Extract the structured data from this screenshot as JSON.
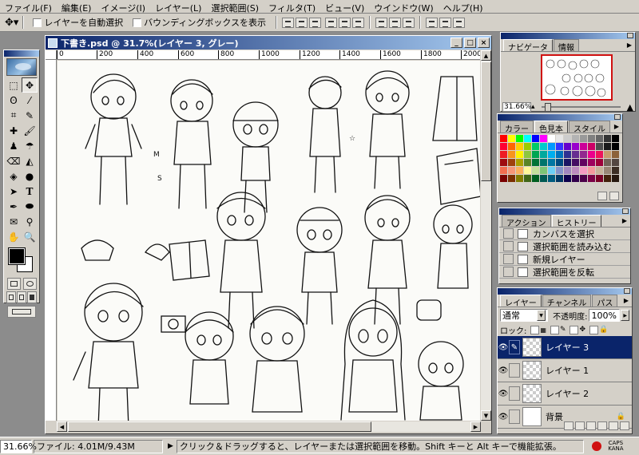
{
  "menu": [
    "ファイル(F)",
    "編集(E)",
    "イメージ(I)",
    "レイヤー(L)",
    "選択範囲(S)",
    "フィルタ(T)",
    "ビュー(V)",
    "ウインドウ(W)",
    "ヘルプ(H)"
  ],
  "options": {
    "auto_select_label": "レイヤーを自動選択",
    "bounding_box_label": "バウンディングボックスを表示"
  },
  "document": {
    "title": "下書き.psd @ 31.7%(レイヤー 3, グレー)",
    "ruler_labels": [
      "0",
      "200",
      "400",
      "600",
      "800",
      "1000",
      "1200",
      "1400",
      "1600",
      "1800",
      "2000"
    ]
  },
  "navigator": {
    "tabs": [
      "ナビゲータ",
      "情報"
    ],
    "zoom": "31.66%"
  },
  "swatches": {
    "tabs": [
      "カラー",
      "色見本",
      "スタイル"
    ],
    "colors": [
      "#ff0000",
      "#ffff00",
      "#00ff00",
      "#00ffff",
      "#0000ff",
      "#ff00ff",
      "#ffffff",
      "#e6e6e6",
      "#cccccc",
      "#b3b3b3",
      "#999999",
      "#808080",
      "#666666",
      "#333333",
      "#000000",
      "#ff0033",
      "#ff6600",
      "#ffcc00",
      "#99cc00",
      "#00cc66",
      "#00cccc",
      "#0099ff",
      "#3333ff",
      "#6600cc",
      "#9900cc",
      "#cc0099",
      "#cc0066",
      "#4d4d4d",
      "#1a1a1a",
      "#000000",
      "#ee1c24",
      "#f7941d",
      "#fff200",
      "#8dc63f",
      "#00a651",
      "#00a99d",
      "#00aeef",
      "#0072bc",
      "#2e3192",
      "#662d91",
      "#92278f",
      "#ec008c",
      "#ed145b",
      "#c69c6d",
      "#8c6239",
      "#9e0b0f",
      "#a0410d",
      "#aba000",
      "#598527",
      "#007236",
      "#00746b",
      "#0076a3",
      "#004a80",
      "#1b1464",
      "#440e62",
      "#630460",
      "#9e005d",
      "#9e0039",
      "#736357",
      "#534741",
      "#f26c4f",
      "#f69679",
      "#fbaf5d",
      "#fff799",
      "#c4df9b",
      "#7cc576",
      "#6dcff6",
      "#8493ca",
      "#a187be",
      "#bd8cbf",
      "#f49ac2",
      "#f5989d",
      "#c7b299",
      "#998675",
      "#3c2e24",
      "#790000",
      "#7b2e00",
      "#827b00",
      "#406618",
      "#005e20",
      "#005952",
      "#005b7f",
      "#003663",
      "#0d004c",
      "#32004b",
      "#4b0049",
      "#7b0046",
      "#7a0026",
      "#42210b",
      "#26180f"
    ]
  },
  "history": {
    "tabs": [
      "アクション",
      "ヒストリー"
    ],
    "items": [
      "カンバスを選択",
      "選択範囲を読み込む",
      "新規レイヤー",
      "選択範囲を反転"
    ]
  },
  "layers": {
    "tabs": [
      "レイヤー",
      "チャンネル",
      "パス"
    ],
    "blend_mode": "通常",
    "opacity_label": "不透明度:",
    "opacity": "100%",
    "lock_label": "ロック:",
    "items": [
      {
        "name": "レイヤー 3"
      },
      {
        "name": "レイヤー 1"
      },
      {
        "name": "レイヤー 2"
      },
      {
        "name": "背景"
      }
    ]
  },
  "status": {
    "zoom": "31.66%",
    "file": "ファイル: 4.01M/9.43M",
    "message": "クリック＆ドラッグすると、レイヤーまたは選択範囲を移動。Shift キーと Alt キーで機能拡張。",
    "caps": "CAPS",
    "kana": "KANA"
  }
}
